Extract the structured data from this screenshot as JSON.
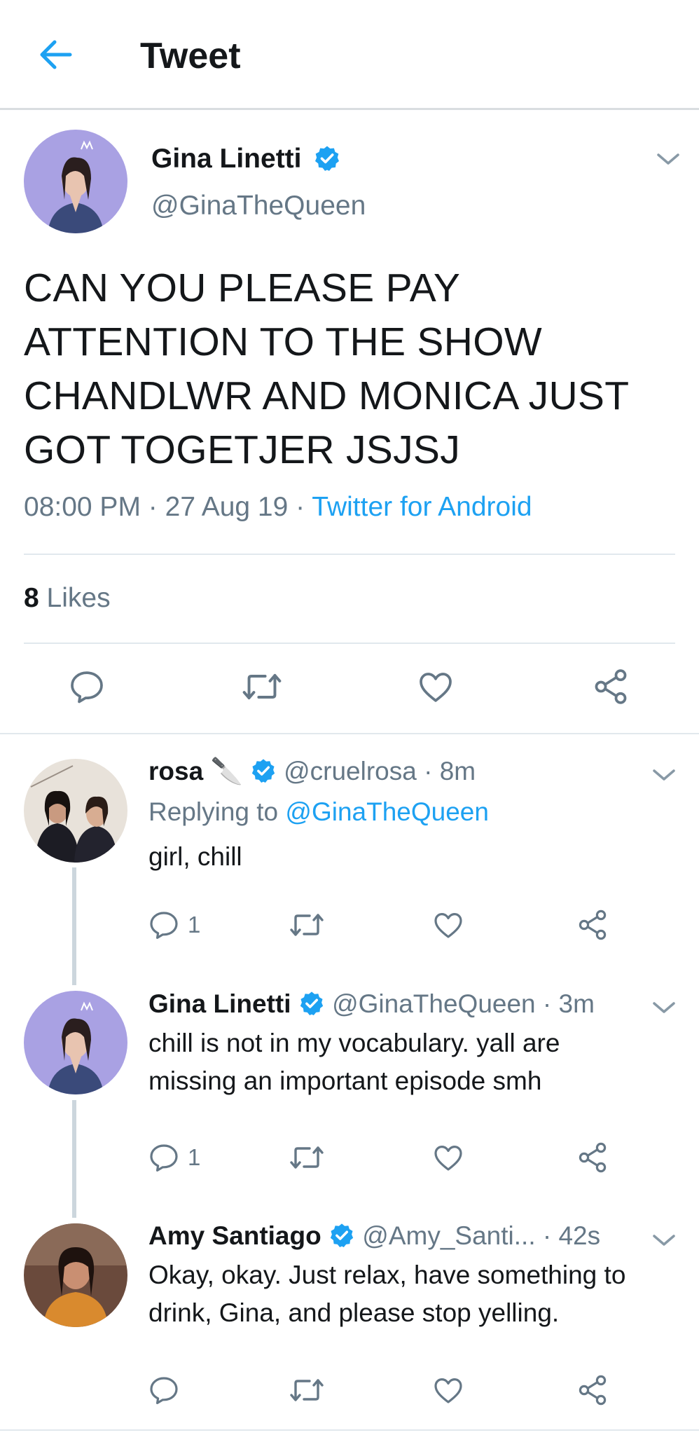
{
  "header": {
    "title": "Tweet",
    "back_icon": "arrow-left-icon"
  },
  "main_tweet": {
    "author_name": "Gina Linetti",
    "handle": "@GinaTheQueen",
    "text_lines": [
      "CAN YOU PLEASE PAY",
      "ATTENTION TO THE SHOW",
      "CHANDLWR AND MONICA JUST",
      "GOT TOGETJER JSJSJ"
    ],
    "time": "08:00 PM",
    "date": "27 Aug 19",
    "source": "Twitter for Android",
    "likes_count": "8",
    "likes_label": "Likes"
  },
  "replies": [
    {
      "author_name": "rosa",
      "emoji": "🔪",
      "handle": "@cruelrosa",
      "time": "8m",
      "replying_prefix": "Replying to",
      "replying_to": "@GinaTheQueen",
      "text_lines": [
        "girl, chill"
      ],
      "reply_count": "1"
    },
    {
      "author_name": "Gina Linetti",
      "handle": "@GinaTheQueen",
      "time": "3m",
      "text_lines": [
        "chill is not in my vocabulary. yall are",
        "missing an important episode smh"
      ],
      "reply_count": "1"
    },
    {
      "author_name": "Amy Santiago",
      "handle": "@Amy_Santi...",
      "time": "42s",
      "text_lines": [
        "Okay, okay. Just relax, have something to",
        "drink, Gina, and please stop yelling."
      ],
      "reply_count": ""
    }
  ],
  "colors": {
    "accent": "#1da1f2",
    "muted": "#657786",
    "text": "#14171a",
    "divider": "#e1e8ed"
  },
  "separator": "·"
}
